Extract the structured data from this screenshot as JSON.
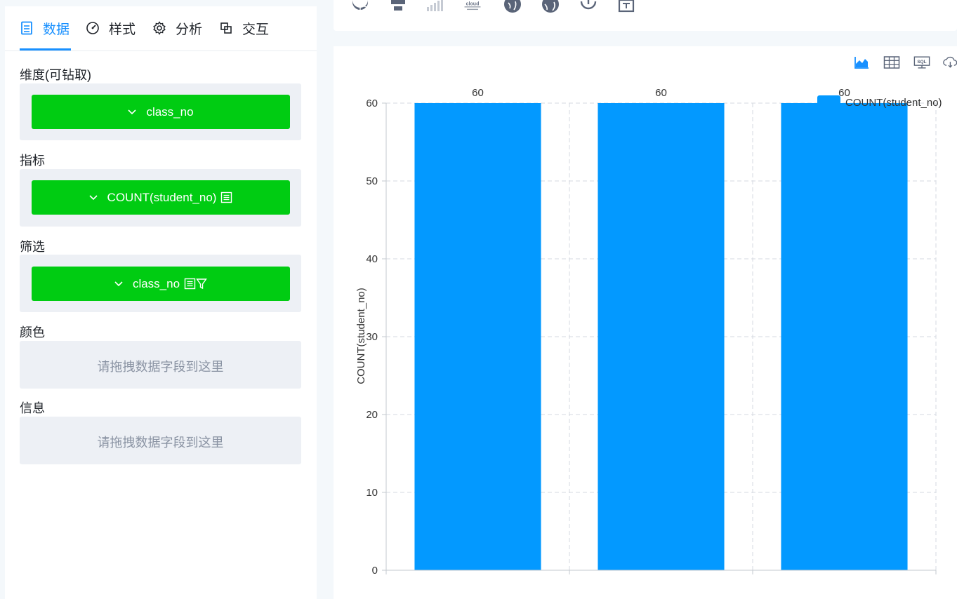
{
  "tabs": [
    {
      "label": "数据",
      "icon": "data-table-icon",
      "active": true
    },
    {
      "label": "样式",
      "icon": "gauge-icon",
      "active": false
    },
    {
      "label": "分析",
      "icon": "gear-icon",
      "active": false
    },
    {
      "label": "交互",
      "icon": "copy-squares-icon",
      "active": false
    }
  ],
  "sections": {
    "dimension": {
      "label": "维度(可钻取)",
      "field": "class_no"
    },
    "measure": {
      "label": "指标",
      "field": "COUNT(student_no)"
    },
    "filter": {
      "label": "筛选",
      "field": "class_no"
    },
    "color": {
      "label": "颜色",
      "placeholder": "请拖拽数据字段到这里"
    },
    "info": {
      "label": "信息",
      "placeholder": "请拖拽数据字段到这里"
    }
  },
  "toolbar_icons": [
    "pie-chart-icon",
    "funnel-chart-icon",
    "bar-signal-icon",
    "word-cloud-icon",
    "globe-icon",
    "world-map-icon",
    "refresh-icon",
    "text-box-icon"
  ],
  "word_cloud_label": "cloud",
  "chart_tool_icons": [
    "area-chart-icon",
    "table-grid-icon",
    "sql-monitor-icon",
    "cloud-download-icon"
  ],
  "sql_label": "SQL",
  "colors": {
    "accent": "#1890ff",
    "pill": "#00cc12",
    "bar": "#0399ff"
  },
  "chart_data": {
    "type": "bar",
    "categories": [
      "",
      "",
      ""
    ],
    "series": [
      {
        "name": "COUNT(student_no)",
        "values": [
          60,
          60,
          60
        ]
      }
    ],
    "data_labels": [
      "60",
      "60",
      "60"
    ],
    "ylabel": "COUNT(student_no)",
    "xlabel": "",
    "ylim": [
      0,
      60
    ],
    "yticks": [
      "0",
      "10",
      "20",
      "30",
      "40",
      "50",
      "60"
    ],
    "grid": true,
    "legend": "top-right"
  }
}
